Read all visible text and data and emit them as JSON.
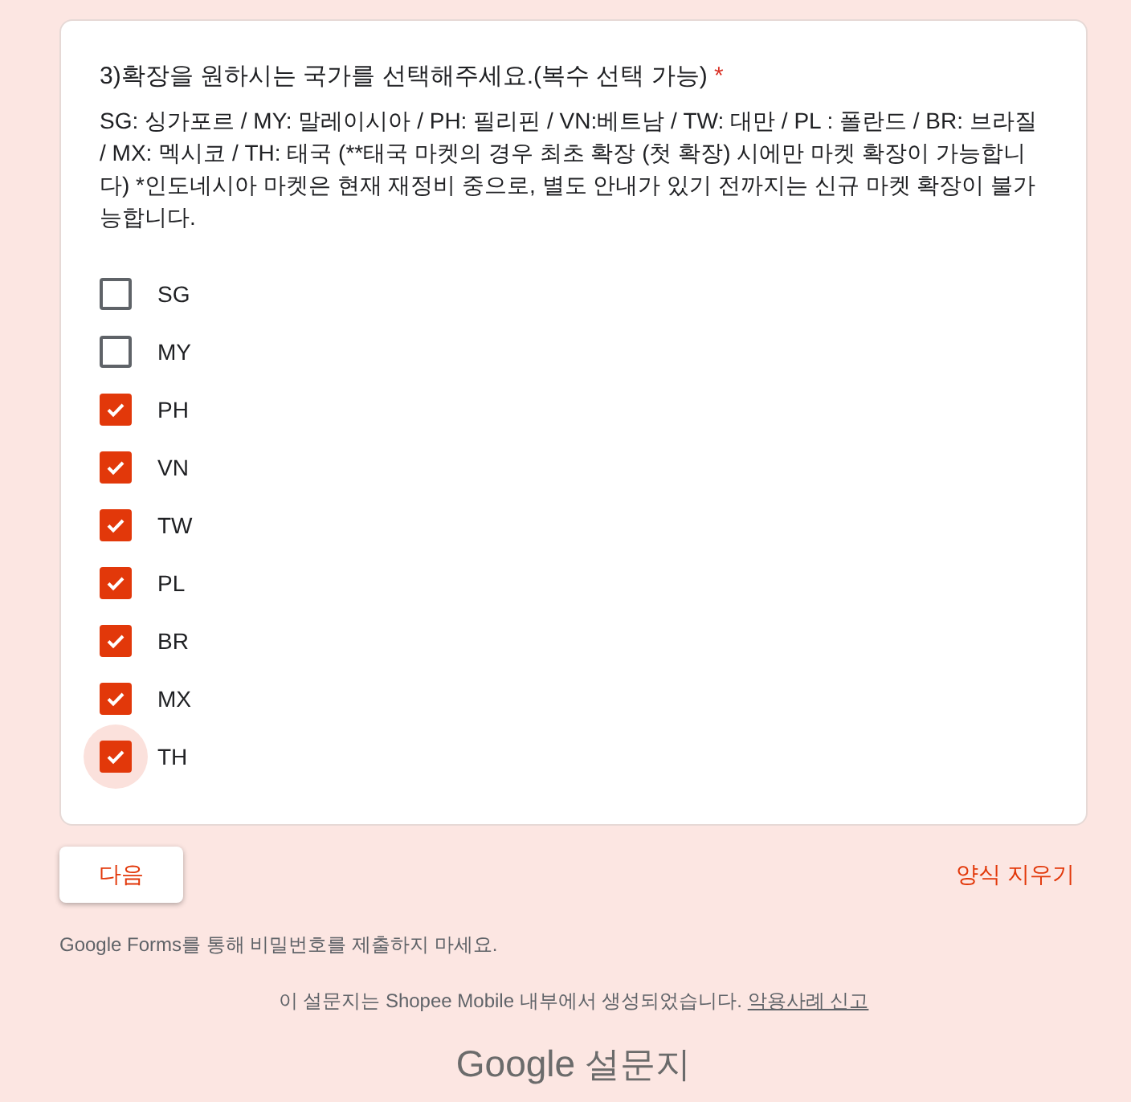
{
  "question": {
    "title": "3)확장을 원하시는 국가를 선택해주세요.(복수 선택 가능)",
    "required_mark": "*",
    "description": "SG: 싱가포르 / MY: 말레이시아  / PH: 필리핀 / VN:베트남 / TW: 대만 / PL : 폴란드 / BR: 브라질  / MX: 멕시코 / TH: 태국 (**태국 마켓의 경우 최초 확장 (첫 확장) 시에만 마켓 확장이 가능합니다) *인도네시아 마켓은 현재 재정비 중으로, 별도 안내가 있기 전까지는 신규 마켓 확장이 불가능합니다.",
    "options": [
      {
        "label": "SG",
        "checked": false,
        "focused": false
      },
      {
        "label": "MY",
        "checked": false,
        "focused": false
      },
      {
        "label": "PH",
        "checked": true,
        "focused": false
      },
      {
        "label": "VN",
        "checked": true,
        "focused": false
      },
      {
        "label": "TW",
        "checked": true,
        "focused": false
      },
      {
        "label": "PL",
        "checked": true,
        "focused": false
      },
      {
        "label": "BR",
        "checked": true,
        "focused": false
      },
      {
        "label": "MX",
        "checked": true,
        "focused": false
      },
      {
        "label": "TH",
        "checked": true,
        "focused": true
      }
    ]
  },
  "next_button": "다음",
  "clear_button": "양식 지우기",
  "password_warning": "Google Forms를 통해 비밀번호를 제출하지 마세요.",
  "footer": {
    "text": "이 설문지는 Shopee Mobile 내부에서 생성되었습니다.",
    "link": "악용사례 신고"
  },
  "brand": {
    "logo": "Google",
    "product": "설문지"
  }
}
